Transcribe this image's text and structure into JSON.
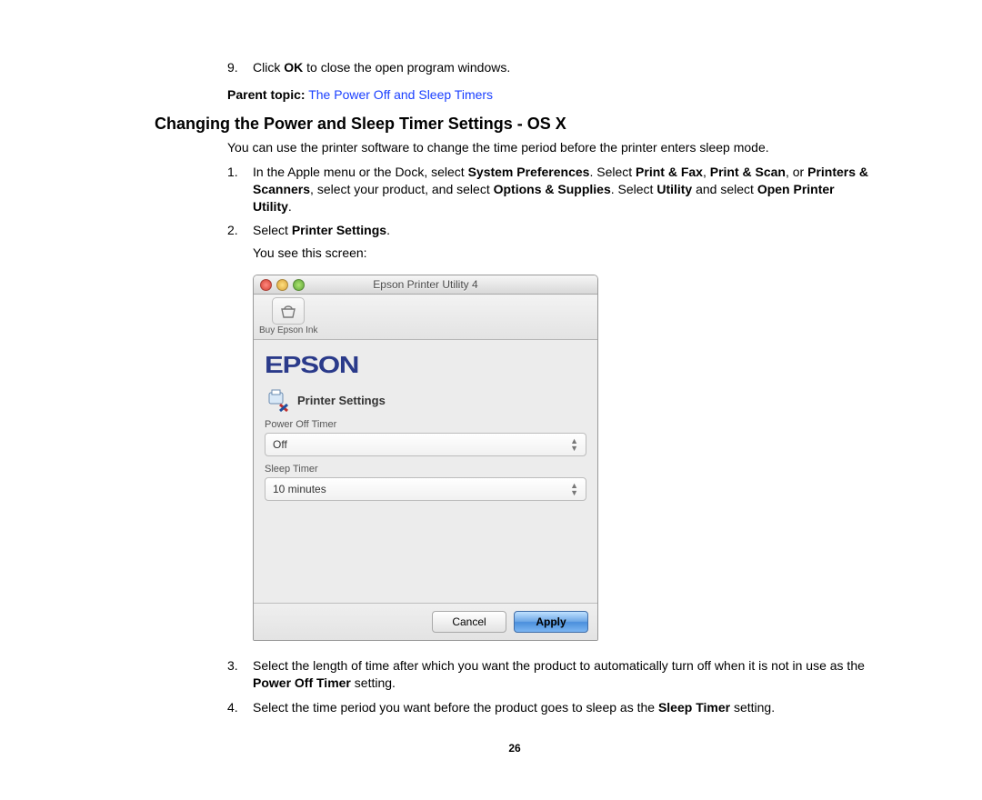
{
  "prev_step": {
    "num": "9.",
    "text_pre": "Click ",
    "bold": "OK",
    "text_post": " to close the open program windows."
  },
  "parent_topic": {
    "label": "Parent topic:",
    "link_text": "The Power Off and Sleep Timers"
  },
  "heading": "Changing the Power and Sleep Timer Settings - OS X",
  "intro": "You can use the printer software to change the time period before the printer enters sleep mode.",
  "steps": {
    "s1": {
      "num": "1.",
      "t1": "In the Apple menu or the Dock, select ",
      "b1": "System Preferences",
      "t2": ". Select ",
      "b2": "Print & Fax",
      "t3": ", ",
      "b3": "Print & Scan",
      "t4": ", or ",
      "b4": "Printers & Scanners",
      "t5": ", select your product, and select ",
      "b5": "Options & Supplies",
      "t6": ". Select ",
      "b6": "Utility",
      "t7": " and select ",
      "b7": "Open Printer Utility",
      "t8": "."
    },
    "s2": {
      "num": "2.",
      "t1": "Select ",
      "b1": "Printer Settings",
      "t2": ".",
      "you_see": "You see this screen:"
    },
    "s3": {
      "num": "3.",
      "t1": "Select the length of time after which you want the product to automatically turn off when it is not in use as the ",
      "b1": "Power Off Timer",
      "t2": " setting."
    },
    "s4": {
      "num": "4.",
      "t1": "Select the time period you want before the product goes to sleep as the ",
      "b1": "Sleep Timer",
      "t2": " setting."
    }
  },
  "window": {
    "title": "Epson Printer Utility 4",
    "toolbar_item": "Buy Epson Ink",
    "brand": "EPSON",
    "section": "Printer Settings",
    "field1_label": "Power Off Timer",
    "field1_value": "Off",
    "field2_label": "Sleep Timer",
    "field2_value": "10 minutes",
    "cancel": "Cancel",
    "apply": "Apply"
  },
  "page_number": "26"
}
